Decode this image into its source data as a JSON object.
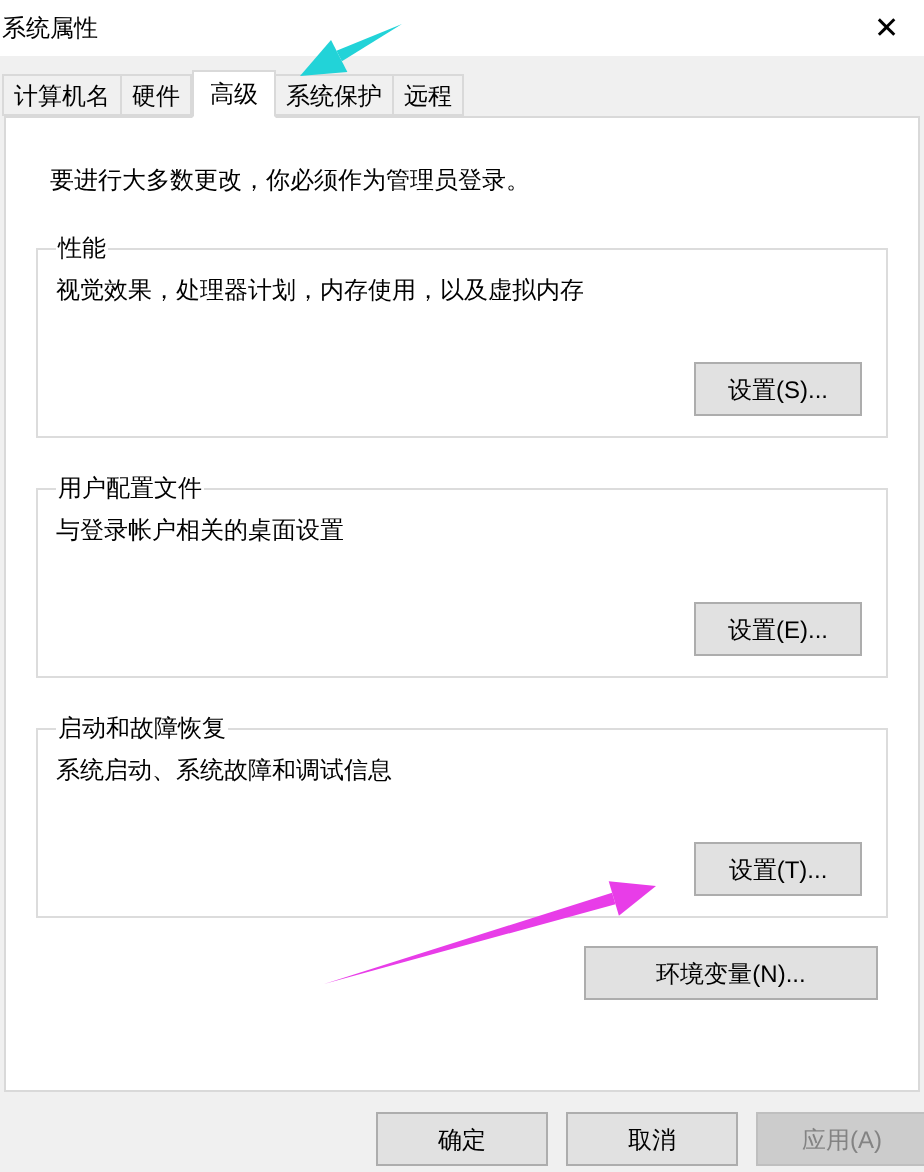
{
  "window": {
    "title": "系统属性",
    "close": "✕"
  },
  "tabs": [
    {
      "label": "计算机名",
      "selected": false
    },
    {
      "label": "硬件",
      "selected": false
    },
    {
      "label": "高级",
      "selected": true
    },
    {
      "label": "系统保护",
      "selected": false
    },
    {
      "label": "远程",
      "selected": false
    }
  ],
  "notice": "要进行大多数更改，你必须作为管理员登录。",
  "groups": [
    {
      "title": "性能",
      "description": "视觉效果，处理器计划，内存使用，以及虚拟内存",
      "button": "设置(S)..."
    },
    {
      "title": "用户配置文件",
      "description": "与登录帐户相关的桌面设置",
      "button": "设置(E)..."
    },
    {
      "title": "启动和故障恢复",
      "description": "系统启动、系统故障和调试信息",
      "button": "设置(T)..."
    }
  ],
  "env_button": "环境变量(N)...",
  "footer_buttons": [
    {
      "label": "确定",
      "disabled": false
    },
    {
      "label": "取消",
      "disabled": false
    },
    {
      "label": "应用(A)",
      "disabled": true
    }
  ],
  "annotations": [
    {
      "kind": "arrow",
      "color": "#22d3d8"
    },
    {
      "kind": "arrow",
      "color": "#e83de8"
    }
  ]
}
